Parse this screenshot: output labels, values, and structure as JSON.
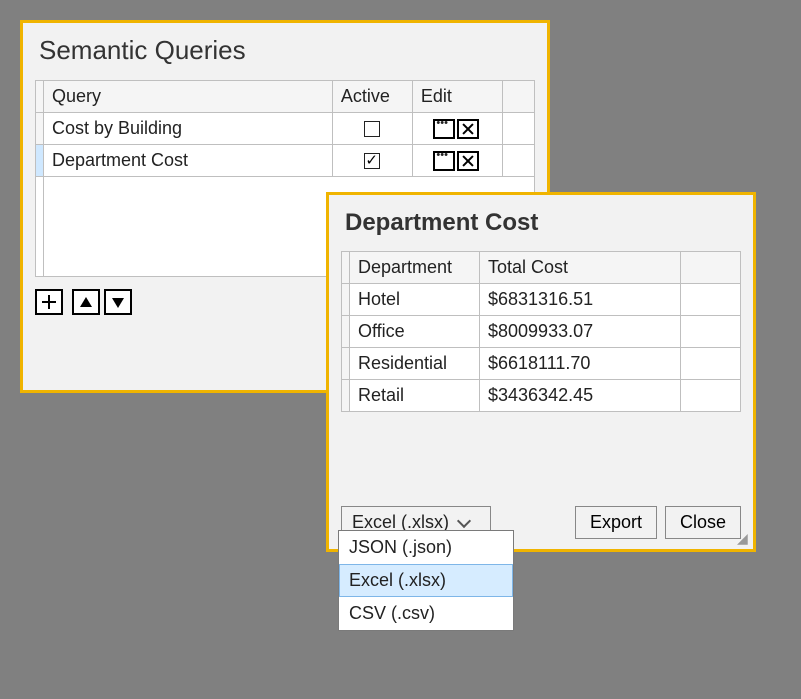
{
  "main": {
    "title": "Semantic Queries",
    "columns": [
      "Query",
      "Active",
      "Edit"
    ],
    "rows": [
      {
        "name": "Cost by Building",
        "active": false,
        "selected": false
      },
      {
        "name": "Department Cost",
        "active": true,
        "selected": true
      }
    ],
    "toolbar": {
      "add": "add",
      "up": "move-up",
      "down": "move-down"
    }
  },
  "results": {
    "title": "Department Cost",
    "columns": [
      "Department",
      "Total Cost"
    ],
    "rows": [
      {
        "dept": "Hotel",
        "cost": "$6831316.51"
      },
      {
        "dept": "Office",
        "cost": "$8009933.07"
      },
      {
        "dept": "Residential",
        "cost": "$6618111.70"
      },
      {
        "dept": "Retail",
        "cost": "$3436342.45"
      }
    ],
    "footer": {
      "format_selected": "Excel (.xlsx)",
      "export": "Export",
      "close": "Close"
    },
    "format_options": [
      {
        "label": "JSON (.json)",
        "hover": false
      },
      {
        "label": "Excel (.xlsx)",
        "hover": true
      },
      {
        "label": "CSV (.csv)",
        "hover": false
      }
    ]
  },
  "chart_data": {
    "type": "table",
    "title": "Department Cost",
    "columns": [
      "Department",
      "Total Cost"
    ],
    "rows": [
      [
        "Hotel",
        6831316.51
      ],
      [
        "Office",
        8009933.07
      ],
      [
        "Residential",
        6618111.7
      ],
      [
        "Retail",
        3436342.45
      ]
    ]
  }
}
